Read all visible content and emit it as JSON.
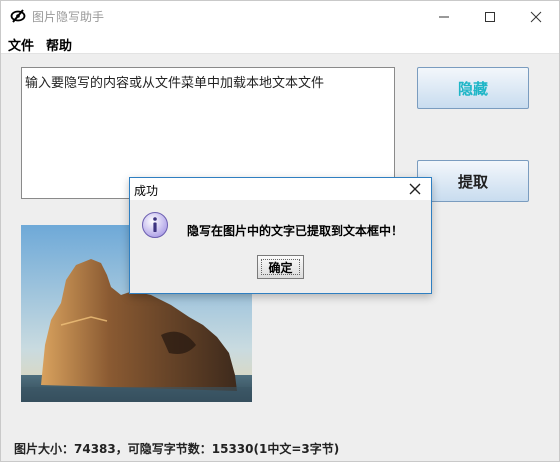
{
  "window": {
    "title": "图片隐写助手"
  },
  "menu": {
    "file": "文件",
    "help": "帮助"
  },
  "text_area": {
    "value": "输入要隐写的内容或从文件菜单中加载本地文本文件"
  },
  "buttons": {
    "hide": "隐藏",
    "extract": "提取"
  },
  "status": {
    "text": "图片大小：74383，可隐写字节数：15330(1中文=3字节)"
  },
  "dialog": {
    "title": "成功",
    "message": "隐写在图片中的文字已提取到文本框中！",
    "ok_label": "确定"
  },
  "colors": {
    "hide_button_text": "#1fb6c7",
    "dialog_border": "#2f7fc1",
    "info_icon": "#a99be6"
  },
  "icons": {
    "app": "eye-slash-icon",
    "info": "info-icon",
    "close": "close-icon"
  }
}
